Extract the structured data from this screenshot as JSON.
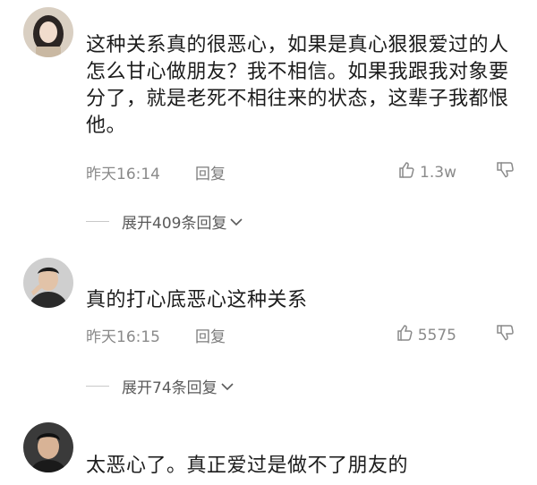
{
  "comments": [
    {
      "text": "这种关系真的很恶心，如果是真心狠狠爱过的人怎么甘心做朋友？我不相信。如果我跟我对象要分了，就是老死不相往来的状态，这辈子我都恨他。",
      "time": "昨天16:14",
      "reply_label": "回复",
      "likes": "1.3w",
      "expand_label": "展开409条回复"
    },
    {
      "text": "真的打心底恶心这种关系",
      "time": "昨天16:15",
      "reply_label": "回复",
      "likes": "5575",
      "expand_label": "展开74条回复"
    },
    {
      "text": "太恶心了。真正爱过是做不了朋友的"
    }
  ],
  "icons": {
    "like": "thumbs-up-icon",
    "dislike": "thumbs-down-icon",
    "expand": "chevron-down-icon"
  },
  "colors": {
    "meta_text": "#8a8a8a",
    "body_text": "#1c1c1c"
  }
}
